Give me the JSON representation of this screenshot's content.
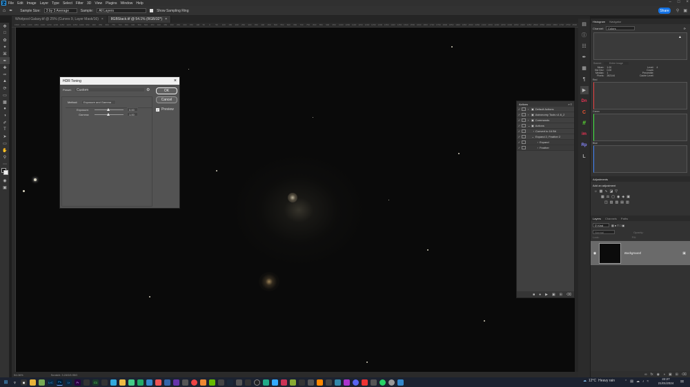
{
  "menu": {
    "logo": "Ps",
    "items": [
      "File",
      "Edit",
      "Image",
      "Layer",
      "Type",
      "Select",
      "Filter",
      "3D",
      "View",
      "Plugins",
      "Window",
      "Help"
    ]
  },
  "options": {
    "sample_size_label": "Sample Size:",
    "sample_size_value": "3 by 3 Average",
    "sample_label": "Sample:",
    "sample_value": "All Layers",
    "show_ring": "Show Sampling Ring",
    "share": "Share"
  },
  "tabs": [
    {
      "label": "Whirlpool Galaxy.tif @ 25% (Curves 9, Layer Mask/16)",
      "active": false
    },
    {
      "label": "8GBStack.tif @ 54.1% (RGB/32*)",
      "active": true
    }
  ],
  "ruler_ticks": [
    "1500",
    "1450",
    "1400",
    "1350",
    "1300",
    "1250",
    "1200",
    "1150",
    "1100",
    "1050",
    "1000",
    "950",
    "900",
    "850",
    "800",
    "750",
    "700",
    "650",
    "600",
    "550",
    "500",
    "450",
    "400",
    "350",
    "300",
    "250",
    "200",
    "150",
    "100",
    "50",
    "0",
    "50",
    "100",
    "150",
    "200",
    "250",
    "300",
    "350",
    "400",
    "450",
    "500",
    "550",
    "600",
    "650",
    "700",
    "750",
    "800",
    "850",
    "900",
    "950",
    "1000",
    "1050",
    "1100",
    "1150",
    "1200",
    "1250",
    "1300",
    "1350",
    "1400",
    "1450",
    "1500",
    "1550",
    "1600",
    "1650",
    "1700",
    "1750",
    "1800",
    "1850",
    "1900",
    "1950",
    "2000",
    "2050",
    "2100",
    "2150",
    "2200",
    "2250",
    "2300",
    "2350",
    "2400",
    "2450",
    "2500",
    "2550",
    "2600",
    "2650",
    "2700",
    "2750",
    "2800"
  ],
  "status": {
    "zoom": "54.06%",
    "scratch": "Scratch: 3.24G/6.95G"
  },
  "hdr": {
    "title": "HDR Toning",
    "preset_label": "Preset:",
    "preset_value": "Custom",
    "method_label": "Method:",
    "method_value": "Exposure and Gamma",
    "exposure_label": "Exposure:",
    "exposure_value": "0.00",
    "gamma_label": "Gamma:",
    "gamma_value": "1.00",
    "ok": "OK",
    "cancel": "Cancel",
    "preview": "Preview"
  },
  "actions": {
    "title": "Actions",
    "rows": [
      "Default Actions",
      "Astronomy Tools v1.6_2",
      "Commands",
      "Actions",
      "Convert to 16 Bit",
      "Expand 2, Feather 2",
      "Expand",
      "Feather"
    ]
  },
  "histogram": {
    "tabs": [
      "Histogram",
      "Navigator"
    ],
    "channel_label": "Channel:",
    "channel_value": "Colors",
    "source_label": "Source:",
    "source_value": "Entire Image",
    "stats_left": [
      "Mean:",
      "Std Dev:",
      "Median:",
      "Pixels:"
    ],
    "stats_left_vals": [
      "1.00",
      "0.00",
      "1",
      "262144"
    ],
    "stats_right": [
      "Level:",
      "Count:",
      "Percentile:",
      "Cache Level:"
    ],
    "stats_right_vals": [
      "",
      "",
      "",
      "4"
    ],
    "red": "Red",
    "green": "Green",
    "blue": "Blue"
  },
  "adjustments": {
    "tab": "Adjustments",
    "add": "Add an adjustment"
  },
  "layers": {
    "tabs": [
      "Layers",
      "Channels",
      "Paths"
    ],
    "kind": "Kind",
    "mode": "Normal",
    "opacity_label": "Opacity:",
    "lock_label": "Lock:",
    "fill_label": "Fill:",
    "layer_name": "Background"
  },
  "taskbar": {
    "weather_temp": "12°C",
    "weather_desc": "Heavy rain",
    "time": "22:27",
    "date": "21/01/2024"
  },
  "colors": {
    "accent": "#1473e6",
    "ps_blue": "#31a8ff"
  }
}
